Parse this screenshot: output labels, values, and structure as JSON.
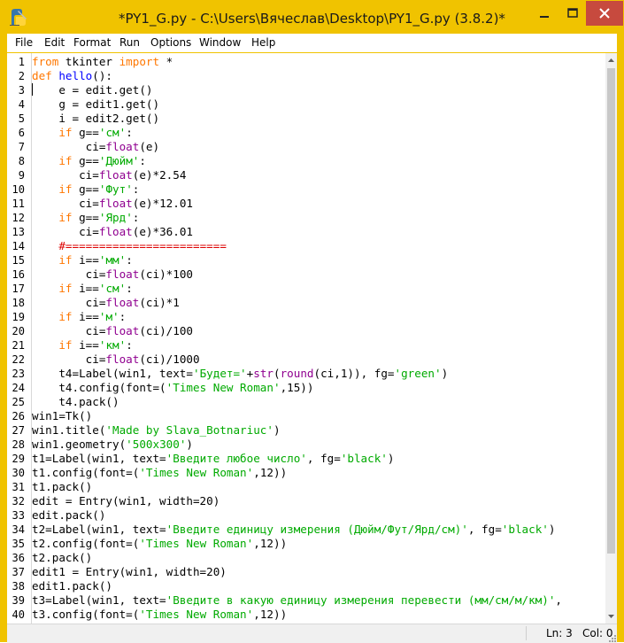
{
  "window": {
    "title": "*PY1_G.py - C:\\Users\\Вячеслав\\Desktop\\PY1_G.py (3.8.2)*",
    "accent": "#f0c300"
  },
  "menu": [
    "File",
    "Edit",
    "Format",
    "Run",
    "Options",
    "Window",
    "Help"
  ],
  "editor": {
    "line_numbers": [
      "1",
      "2",
      "3",
      "4",
      "5",
      "6",
      "7",
      "8",
      "9",
      "10",
      "11",
      "12",
      "13",
      "14",
      "15",
      "16",
      "17",
      "18",
      "19",
      "20",
      "21",
      "22",
      "23",
      "24",
      "25",
      "26",
      "27",
      "28",
      "29",
      "30",
      "31",
      "32",
      "33",
      "34",
      "35",
      "36",
      "37",
      "38",
      "39",
      "40"
    ],
    "lines": [
      "from tkinter import *",
      "def hello():",
      "    e = edit.get()",
      "    g = edit1.get()",
      "    i = edit2.get()",
      "    if g=='см':",
      "        ci=float(e)",
      "    if g=='Дюйм':",
      "       ci=float(e)*2.54",
      "    if g=='Фут':",
      "       ci=float(e)*12.01",
      "    if g=='Ярд':",
      "       ci=float(e)*36.01",
      "    #========================",
      "    if i=='мм':",
      "        ci=float(ci)*100",
      "    if i=='см':",
      "        ci=float(ci)*1",
      "    if i=='м':",
      "        ci=float(ci)/100",
      "    if i=='км':",
      "        ci=float(ci)/1000",
      "    t4=Label(win1, text='Будет='+str(round(ci,1)), fg='green')",
      "    t4.config(font=('Times New Roman',15))",
      "    t4.pack()",
      "win1=Tk()",
      "win1.title('Made by Slava_Botnariuc')",
      "win1.geometry('500x300')",
      "t1=Label(win1, text='Введите любое число', fg='black')",
      "t1.config(font=('Times New Roman',12))",
      "t1.pack()",
      "edit = Entry(win1, width=20)",
      "edit.pack()",
      "t2=Label(win1, text='Введите единицу измерения (Дюйм/Фут/Ярд/см)', fg='black')",
      "t2.config(font=('Times New Roman',12))",
      "t2.pack()",
      "edit1 = Entry(win1, width=20)",
      "edit1.pack()",
      "t3=Label(win1, text='Введите в какую единицу измерения перевести (мм/см/м/км)',",
      "t3.config(font=('Times New Roman',12))"
    ]
  },
  "status": {
    "ln": "Ln: 3",
    "col": "Col: 0"
  },
  "colors": {
    "keyword": "#ff7700",
    "string": "#00aa00",
    "builtin": "#900090",
    "comment": "#dd0000",
    "def_name": "#0000ff"
  }
}
